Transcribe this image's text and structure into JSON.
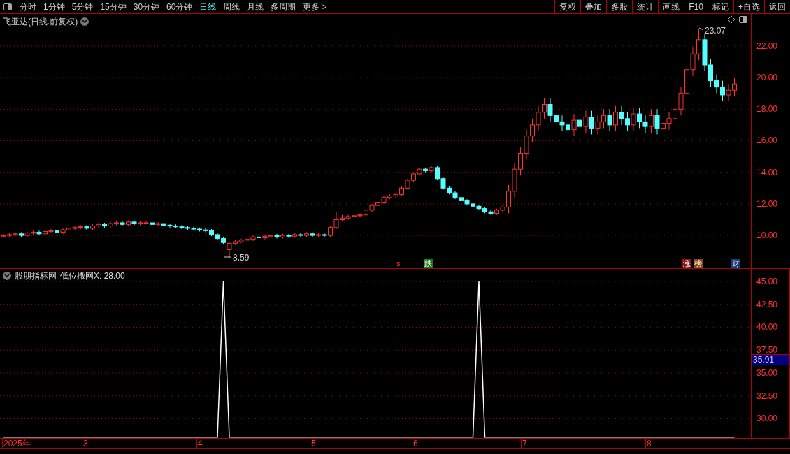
{
  "toolbar": {
    "periods": [
      {
        "label": "分时",
        "selected": false
      },
      {
        "label": "1分钟",
        "selected": false
      },
      {
        "label": "5分钟",
        "selected": false
      },
      {
        "label": "15分钟",
        "selected": false
      },
      {
        "label": "30分钟",
        "selected": false
      },
      {
        "label": "60分钟",
        "selected": false
      },
      {
        "label": "日线",
        "selected": true
      },
      {
        "label": "周线",
        "selected": false
      },
      {
        "label": "月线",
        "selected": false
      },
      {
        "label": "多周期",
        "selected": false
      },
      {
        "label": "更多 >",
        "selected": false
      }
    ],
    "buttons": [
      "复权",
      "叠加",
      "多股",
      "统计",
      "画线",
      "F10",
      "标记",
      "+自选",
      "返回"
    ]
  },
  "price_panel": {
    "title": "飞亚达(日线.前复权)",
    "high_label": "23.07",
    "low_label": "8.59",
    "markers": [
      {
        "text": "s",
        "color": "#000000"
      },
      {
        "text": "跌",
        "color": "#1a7a1a"
      },
      {
        "text": "涨",
        "color": "#8b1010"
      },
      {
        "text": "榜",
        "color": "#8a4a10"
      },
      {
        "text": "财",
        "color": "#1a3a7a"
      }
    ],
    "chart_data": {
      "type": "candlestick",
      "grid": true,
      "ylim": [
        7.88,
        24.03
      ],
      "yticks": [
        {
          "value": 22,
          "label": "22.00"
        },
        {
          "value": 20,
          "label": "20.00"
        },
        {
          "value": 18,
          "label": "18.00"
        },
        {
          "value": 16,
          "label": "16.00"
        },
        {
          "value": 14,
          "label": "14.00"
        },
        {
          "value": 12,
          "label": "12.00"
        },
        {
          "value": 10,
          "label": "10.00"
        }
      ],
      "ohlc": [
        [
          9.95,
          10.1,
          9.85,
          10.0
        ],
        [
          10.0,
          10.15,
          9.9,
          10.05
        ],
        [
          10.05,
          10.2,
          9.95,
          10.1
        ],
        [
          10.1,
          10.2,
          9.9,
          10.0
        ],
        [
          10.0,
          10.25,
          9.9,
          10.15
        ],
        [
          10.15,
          10.3,
          10.05,
          10.2
        ],
        [
          10.2,
          10.3,
          10.0,
          10.1
        ],
        [
          10.1,
          10.35,
          10.0,
          10.25
        ],
        [
          10.25,
          10.4,
          10.15,
          10.3
        ],
        [
          10.3,
          10.4,
          10.1,
          10.2
        ],
        [
          10.2,
          10.45,
          10.1,
          10.35
        ],
        [
          10.35,
          10.55,
          10.25,
          10.45
        ],
        [
          10.45,
          10.6,
          10.35,
          10.5
        ],
        [
          10.5,
          10.65,
          10.4,
          10.55
        ],
        [
          10.55,
          10.65,
          10.35,
          10.45
        ],
        [
          10.45,
          10.7,
          10.35,
          10.6
        ],
        [
          10.6,
          10.8,
          10.5,
          10.7
        ],
        [
          10.7,
          10.8,
          10.5,
          10.6
        ],
        [
          10.6,
          10.85,
          10.5,
          10.75
        ],
        [
          10.75,
          10.9,
          10.65,
          10.8
        ],
        [
          10.8,
          10.9,
          10.6,
          10.7
        ],
        [
          10.7,
          10.95,
          10.6,
          10.85
        ],
        [
          10.85,
          10.95,
          10.65,
          10.75
        ],
        [
          10.75,
          10.9,
          10.65,
          10.8
        ],
        [
          10.8,
          10.9,
          10.7,
          10.8
        ],
        [
          10.8,
          10.9,
          10.6,
          10.7
        ],
        [
          10.7,
          10.85,
          10.6,
          10.75
        ],
        [
          10.75,
          10.85,
          10.55,
          10.65
        ],
        [
          10.65,
          10.75,
          10.5,
          10.6
        ],
        [
          10.6,
          10.7,
          10.45,
          10.55
        ],
        [
          10.55,
          10.65,
          10.4,
          10.5
        ],
        [
          10.5,
          10.6,
          10.35,
          10.45
        ],
        [
          10.45,
          10.55,
          10.3,
          10.4
        ],
        [
          10.4,
          10.5,
          10.25,
          10.35
        ],
        [
          10.35,
          10.45,
          10.2,
          10.3
        ],
        [
          10.3,
          10.4,
          9.95,
          10.05
        ],
        [
          10.05,
          10.15,
          9.7,
          9.8
        ],
        [
          9.8,
          9.9,
          9.45,
          9.55
        ],
        [
          9.1,
          9.6,
          8.59,
          9.5
        ],
        [
          9.5,
          9.7,
          9.4,
          9.6
        ],
        [
          9.6,
          9.8,
          9.5,
          9.7
        ],
        [
          9.7,
          9.85,
          9.6,
          9.75
        ],
        [
          9.75,
          10.0,
          9.65,
          9.9
        ],
        [
          9.9,
          10.0,
          9.75,
          9.85
        ],
        [
          9.85,
          10.05,
          9.75,
          9.95
        ],
        [
          9.95,
          10.1,
          9.85,
          10.0
        ],
        [
          10.0,
          10.1,
          9.8,
          9.9
        ],
        [
          9.9,
          10.1,
          9.8,
          10.0
        ],
        [
          10.0,
          10.1,
          9.85,
          9.95
        ],
        [
          9.95,
          10.15,
          9.85,
          10.05
        ],
        [
          10.05,
          10.15,
          9.9,
          10.0
        ],
        [
          10.0,
          10.2,
          9.9,
          10.1
        ],
        [
          10.1,
          10.2,
          9.9,
          10.0
        ],
        [
          10.0,
          10.15,
          9.9,
          10.05
        ],
        [
          10.05,
          10.15,
          9.9,
          10.0
        ],
        [
          10.0,
          10.6,
          9.9,
          10.5
        ],
        [
          10.5,
          11.5,
          10.4,
          11.0
        ],
        [
          11.0,
          11.3,
          10.9,
          11.1
        ],
        [
          11.1,
          11.3,
          11.0,
          11.2
        ],
        [
          11.2,
          11.35,
          11.1,
          11.25
        ],
        [
          11.25,
          11.4,
          11.15,
          11.3
        ],
        [
          11.3,
          11.7,
          11.2,
          11.6
        ],
        [
          11.6,
          12.0,
          11.5,
          11.9
        ],
        [
          11.9,
          12.2,
          11.8,
          12.1
        ],
        [
          12.1,
          12.5,
          12.0,
          12.4
        ],
        [
          12.4,
          12.6,
          12.3,
          12.5
        ],
        [
          12.5,
          12.7,
          12.4,
          12.6
        ],
        [
          12.6,
          13.1,
          12.5,
          13.0
        ],
        [
          13.0,
          13.6,
          12.9,
          13.5
        ],
        [
          13.5,
          14.0,
          13.4,
          13.9
        ],
        [
          13.9,
          14.3,
          13.8,
          14.2
        ],
        [
          14.2,
          14.3,
          14.0,
          14.1
        ],
        [
          14.1,
          14.4,
          14.0,
          14.3
        ],
        [
          14.3,
          14.4,
          13.5,
          13.6
        ],
        [
          13.6,
          13.7,
          12.9,
          13.0
        ],
        [
          13.0,
          13.1,
          12.6,
          12.7
        ],
        [
          12.7,
          12.8,
          12.3,
          12.4
        ],
        [
          12.4,
          12.5,
          12.1,
          12.2
        ],
        [
          12.2,
          12.3,
          11.9,
          12.0
        ],
        [
          12.0,
          12.1,
          11.75,
          11.85
        ],
        [
          11.85,
          11.95,
          11.6,
          11.7
        ],
        [
          11.7,
          11.8,
          11.4,
          11.5
        ],
        [
          11.5,
          11.6,
          11.3,
          11.4
        ],
        [
          11.4,
          11.7,
          11.3,
          11.6
        ],
        [
          11.6,
          11.9,
          11.5,
          11.8
        ],
        [
          11.8,
          13.2,
          11.4,
          12.8
        ],
        [
          12.8,
          14.6,
          12.4,
          14.2
        ],
        [
          14.2,
          15.6,
          13.8,
          15.2
        ],
        [
          15.2,
          16.7,
          14.8,
          16.3
        ],
        [
          16.3,
          17.4,
          15.9,
          17.0
        ],
        [
          17.0,
          18.2,
          16.6,
          17.8
        ],
        [
          17.8,
          18.7,
          17.4,
          18.3
        ],
        [
          18.3,
          18.7,
          17.2,
          17.6
        ],
        [
          17.6,
          18.0,
          16.8,
          17.2
        ],
        [
          17.2,
          17.6,
          16.6,
          17.0
        ],
        [
          17.0,
          17.4,
          16.3,
          16.7
        ],
        [
          16.7,
          17.7,
          16.3,
          17.3
        ],
        [
          17.3,
          17.7,
          16.5,
          16.9
        ],
        [
          16.9,
          17.9,
          16.5,
          17.5
        ],
        [
          17.5,
          17.9,
          16.4,
          16.8
        ],
        [
          16.8,
          17.6,
          16.4,
          17.2
        ],
        [
          17.2,
          18.0,
          16.8,
          17.6
        ],
        [
          17.6,
          18.0,
          16.6,
          17.0
        ],
        [
          17.0,
          18.2,
          16.6,
          17.8
        ],
        [
          17.8,
          18.2,
          17.0,
          17.4
        ],
        [
          17.4,
          17.8,
          16.6,
          17.0
        ],
        [
          17.0,
          18.1,
          16.6,
          17.7
        ],
        [
          17.7,
          18.1,
          16.8,
          17.2
        ],
        [
          17.2,
          17.6,
          16.5,
          16.9
        ],
        [
          16.9,
          18.0,
          16.5,
          17.6
        ],
        [
          17.6,
          18.0,
          16.4,
          16.8
        ],
        [
          16.8,
          17.5,
          16.4,
          17.1
        ],
        [
          17.1,
          17.8,
          16.7,
          17.4
        ],
        [
          17.4,
          18.4,
          17.0,
          18.0
        ],
        [
          18.0,
          19.4,
          17.6,
          19.0
        ],
        [
          19.0,
          20.9,
          18.6,
          20.5
        ],
        [
          20.5,
          21.9,
          20.1,
          21.5
        ],
        [
          21.5,
          23.07,
          21.1,
          22.4
        ],
        [
          22.4,
          22.8,
          20.4,
          20.8
        ],
        [
          20.8,
          21.2,
          19.4,
          19.8
        ],
        [
          19.8,
          20.2,
          19.0,
          19.4
        ],
        [
          19.4,
          19.8,
          18.5,
          18.9
        ],
        [
          18.9,
          19.6,
          18.5,
          19.2
        ],
        [
          19.2,
          20.0,
          18.8,
          19.6
        ]
      ]
    }
  },
  "indicator_panel": {
    "name": "股朋指标网",
    "reading": "低位撒网X: 28.00",
    "cursor_value": "35.91",
    "chart_data": {
      "type": "line",
      "grid": true,
      "ylim": [
        27.9,
        45
      ],
      "yticks": [
        {
          "value": 30,
          "label": "30.00"
        },
        {
          "value": 32.5,
          "label": "32.50"
        },
        {
          "value": 35,
          "label": "35.00"
        },
        {
          "value": 37.5,
          "label": "37.50"
        },
        {
          "value": 40,
          "label": "40.00"
        },
        {
          "value": 42.5,
          "label": "42.50"
        },
        {
          "value": 45,
          "label": "45.00"
        }
      ],
      "series": [
        {
          "color": "#ffffff",
          "values": [
            28,
            28,
            28,
            28,
            28,
            28,
            28,
            28,
            28,
            28,
            28,
            28,
            28,
            28,
            28,
            28,
            28,
            28,
            28,
            28,
            28,
            28,
            28,
            28,
            28,
            28,
            28,
            28,
            28,
            28,
            28,
            28,
            28,
            28,
            28,
            28,
            28,
            45,
            28,
            28,
            28,
            28,
            28,
            28,
            28,
            28,
            28,
            28,
            28,
            28,
            28,
            28,
            28,
            28,
            28,
            28,
            28,
            28,
            28,
            28,
            28,
            28,
            28,
            28,
            28,
            28,
            28,
            28,
            28,
            28,
            28,
            28,
            28,
            28,
            28,
            28,
            28,
            28,
            28,
            28,
            45,
            28,
            28,
            28,
            28,
            28,
            28,
            28,
            28,
            28,
            28,
            28,
            28,
            28,
            28,
            28,
            28,
            28,
            28,
            28,
            28,
            28,
            28,
            28,
            28,
            28,
            28,
            28,
            28,
            28,
            28,
            28,
            28,
            28,
            28,
            28,
            28,
            28,
            28,
            28,
            28,
            28,
            28,
            28
          ]
        }
      ]
    }
  },
  "date_axis": [
    "2025年",
    "3",
    "4",
    "5",
    "6",
    "7",
    "8"
  ]
}
